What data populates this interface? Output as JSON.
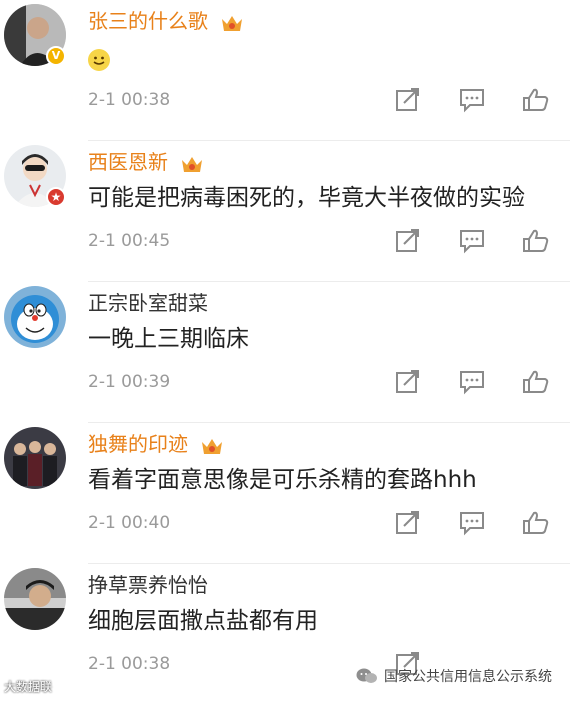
{
  "comments": [
    {
      "username": "张三的什么歌",
      "vip": true,
      "text_emoji": "smile",
      "text": "",
      "time": "2-1 00:38"
    },
    {
      "username": "西医恩新",
      "vip": true,
      "text": "可能是把病毒困死的，毕竟大半夜做的实验",
      "time": "2-1 00:45"
    },
    {
      "username": "正宗卧室甜菜",
      "vip": false,
      "text": "一晚上三期临床",
      "time": "2-1 00:39"
    },
    {
      "username": "独舞的印迹",
      "vip": true,
      "text": "看着字面意思像是可乐杀精的套路hhh",
      "time": "2-1 00:40"
    },
    {
      "username": "挣草票养怡怡",
      "vip": false,
      "text": "细胞层面撒点盐都有用",
      "time": "2-1 00:38"
    }
  ],
  "footer": {
    "left_watermark": "大数据联",
    "right_watermark": "国家公共信用信息公示系统"
  },
  "colors": {
    "vip_name": "#e8811a",
    "meta": "#9a9a9a",
    "icon": "#8a8a8a"
  }
}
